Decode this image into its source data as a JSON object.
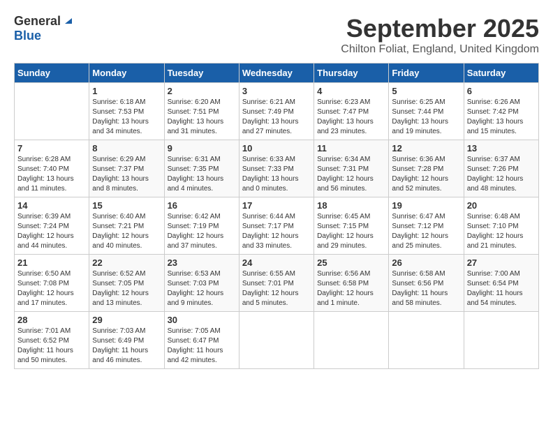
{
  "header": {
    "logo_general": "General",
    "logo_blue": "Blue",
    "month_title": "September 2025",
    "location": "Chilton Foliat, England, United Kingdom"
  },
  "calendar": {
    "columns": [
      "Sunday",
      "Monday",
      "Tuesday",
      "Wednesday",
      "Thursday",
      "Friday",
      "Saturday"
    ],
    "weeks": [
      [
        {
          "day": "",
          "content": ""
        },
        {
          "day": "1",
          "content": "Sunrise: 6:18 AM\nSunset: 7:53 PM\nDaylight: 13 hours\nand 34 minutes."
        },
        {
          "day": "2",
          "content": "Sunrise: 6:20 AM\nSunset: 7:51 PM\nDaylight: 13 hours\nand 31 minutes."
        },
        {
          "day": "3",
          "content": "Sunrise: 6:21 AM\nSunset: 7:49 PM\nDaylight: 13 hours\nand 27 minutes."
        },
        {
          "day": "4",
          "content": "Sunrise: 6:23 AM\nSunset: 7:47 PM\nDaylight: 13 hours\nand 23 minutes."
        },
        {
          "day": "5",
          "content": "Sunrise: 6:25 AM\nSunset: 7:44 PM\nDaylight: 13 hours\nand 19 minutes."
        },
        {
          "day": "6",
          "content": "Sunrise: 6:26 AM\nSunset: 7:42 PM\nDaylight: 13 hours\nand 15 minutes."
        }
      ],
      [
        {
          "day": "7",
          "content": "Sunrise: 6:28 AM\nSunset: 7:40 PM\nDaylight: 13 hours\nand 11 minutes."
        },
        {
          "day": "8",
          "content": "Sunrise: 6:29 AM\nSunset: 7:37 PM\nDaylight: 13 hours\nand 8 minutes."
        },
        {
          "day": "9",
          "content": "Sunrise: 6:31 AM\nSunset: 7:35 PM\nDaylight: 13 hours\nand 4 minutes."
        },
        {
          "day": "10",
          "content": "Sunrise: 6:33 AM\nSunset: 7:33 PM\nDaylight: 13 hours\nand 0 minutes."
        },
        {
          "day": "11",
          "content": "Sunrise: 6:34 AM\nSunset: 7:31 PM\nDaylight: 12 hours\nand 56 minutes."
        },
        {
          "day": "12",
          "content": "Sunrise: 6:36 AM\nSunset: 7:28 PM\nDaylight: 12 hours\nand 52 minutes."
        },
        {
          "day": "13",
          "content": "Sunrise: 6:37 AM\nSunset: 7:26 PM\nDaylight: 12 hours\nand 48 minutes."
        }
      ],
      [
        {
          "day": "14",
          "content": "Sunrise: 6:39 AM\nSunset: 7:24 PM\nDaylight: 12 hours\nand 44 minutes."
        },
        {
          "day": "15",
          "content": "Sunrise: 6:40 AM\nSunset: 7:21 PM\nDaylight: 12 hours\nand 40 minutes."
        },
        {
          "day": "16",
          "content": "Sunrise: 6:42 AM\nSunset: 7:19 PM\nDaylight: 12 hours\nand 37 minutes."
        },
        {
          "day": "17",
          "content": "Sunrise: 6:44 AM\nSunset: 7:17 PM\nDaylight: 12 hours\nand 33 minutes."
        },
        {
          "day": "18",
          "content": "Sunrise: 6:45 AM\nSunset: 7:15 PM\nDaylight: 12 hours\nand 29 minutes."
        },
        {
          "day": "19",
          "content": "Sunrise: 6:47 AM\nSunset: 7:12 PM\nDaylight: 12 hours\nand 25 minutes."
        },
        {
          "day": "20",
          "content": "Sunrise: 6:48 AM\nSunset: 7:10 PM\nDaylight: 12 hours\nand 21 minutes."
        }
      ],
      [
        {
          "day": "21",
          "content": "Sunrise: 6:50 AM\nSunset: 7:08 PM\nDaylight: 12 hours\nand 17 minutes."
        },
        {
          "day": "22",
          "content": "Sunrise: 6:52 AM\nSunset: 7:05 PM\nDaylight: 12 hours\nand 13 minutes."
        },
        {
          "day": "23",
          "content": "Sunrise: 6:53 AM\nSunset: 7:03 PM\nDaylight: 12 hours\nand 9 minutes."
        },
        {
          "day": "24",
          "content": "Sunrise: 6:55 AM\nSunset: 7:01 PM\nDaylight: 12 hours\nand 5 minutes."
        },
        {
          "day": "25",
          "content": "Sunrise: 6:56 AM\nSunset: 6:58 PM\nDaylight: 12 hours\nand 1 minute."
        },
        {
          "day": "26",
          "content": "Sunrise: 6:58 AM\nSunset: 6:56 PM\nDaylight: 11 hours\nand 58 minutes."
        },
        {
          "day": "27",
          "content": "Sunrise: 7:00 AM\nSunset: 6:54 PM\nDaylight: 11 hours\nand 54 minutes."
        }
      ],
      [
        {
          "day": "28",
          "content": "Sunrise: 7:01 AM\nSunset: 6:52 PM\nDaylight: 11 hours\nand 50 minutes."
        },
        {
          "day": "29",
          "content": "Sunrise: 7:03 AM\nSunset: 6:49 PM\nDaylight: 11 hours\nand 46 minutes."
        },
        {
          "day": "30",
          "content": "Sunrise: 7:05 AM\nSunset: 6:47 PM\nDaylight: 11 hours\nand 42 minutes."
        },
        {
          "day": "",
          "content": ""
        },
        {
          "day": "",
          "content": ""
        },
        {
          "day": "",
          "content": ""
        },
        {
          "day": "",
          "content": ""
        }
      ]
    ]
  }
}
